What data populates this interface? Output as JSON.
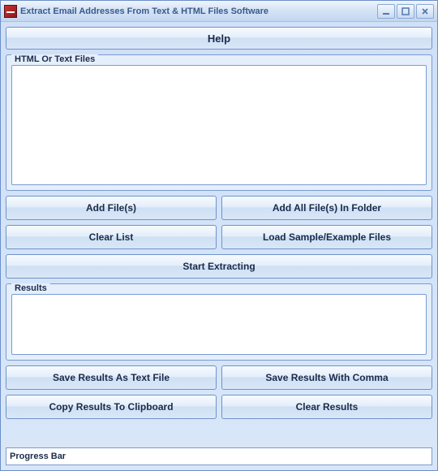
{
  "titlebar": {
    "title": "Extract Email Addresses From Text & HTML Files Software"
  },
  "buttons": {
    "help": "Help",
    "add_files": "Add File(s)",
    "add_folder": "Add All File(s) In Folder",
    "clear_list": "Clear List",
    "load_sample": "Load Sample/Example Files",
    "start": "Start Extracting",
    "save_text": "Save Results As Text File",
    "save_comma": "Save Results With Comma",
    "copy_clip": "Copy Results To Clipboard",
    "clear_results": "Clear Results"
  },
  "groups": {
    "files_label": "HTML Or Text Files",
    "results_label": "Results"
  },
  "progress": {
    "label": "Progress Bar"
  }
}
